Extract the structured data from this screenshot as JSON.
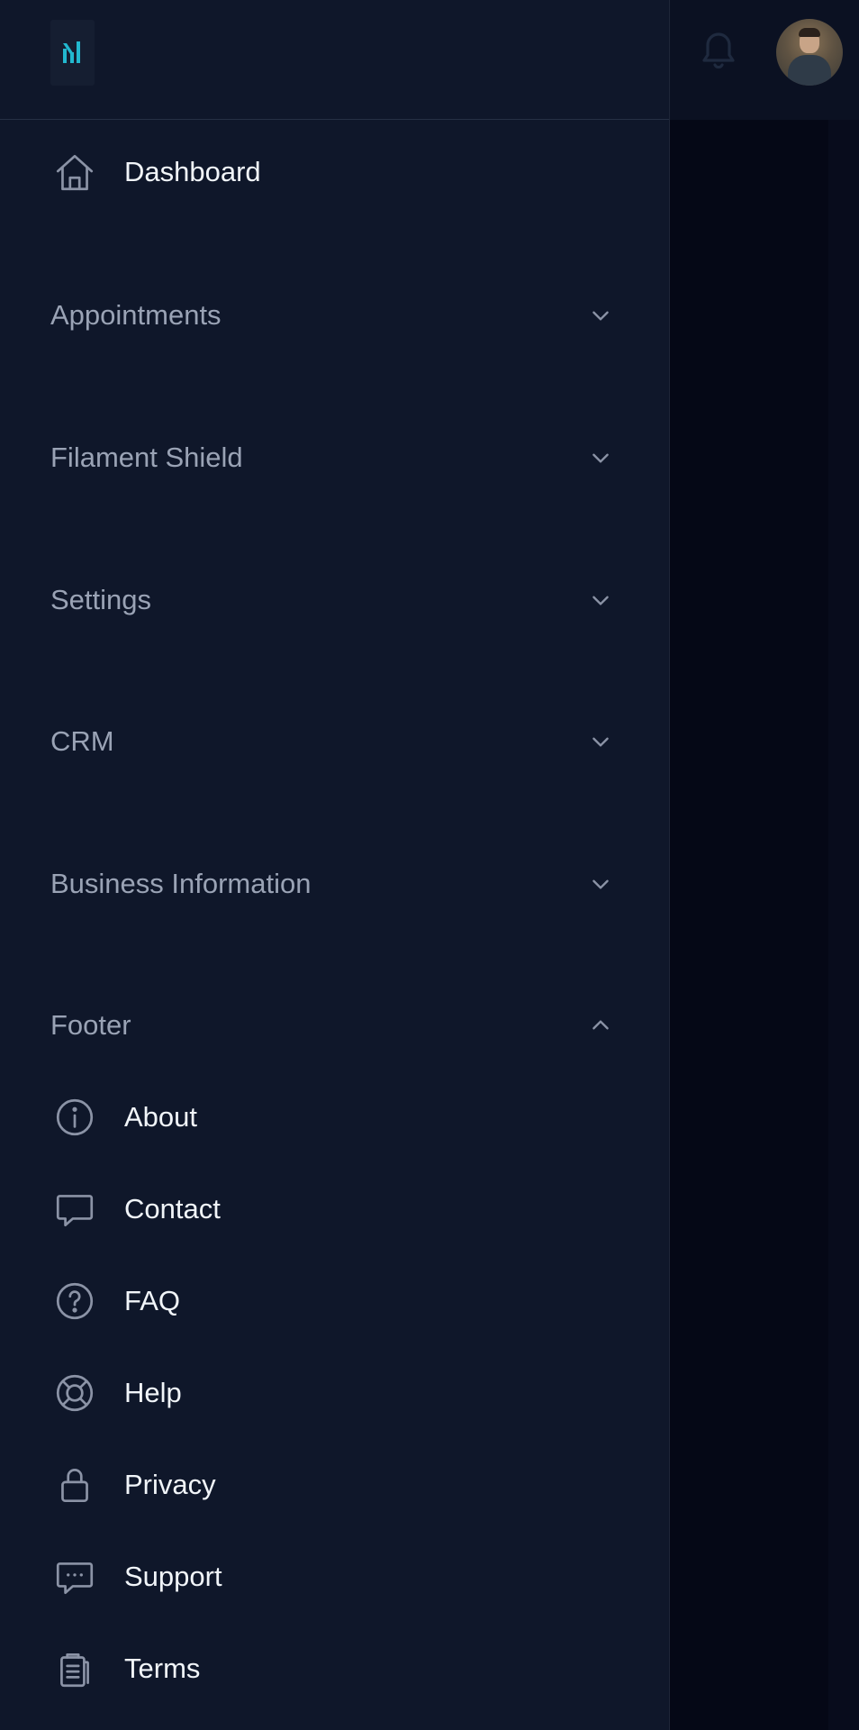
{
  "brand": {
    "logo_icon": "brand-logo-icon",
    "accent": "#22b8cf"
  },
  "topbar": {
    "notification_icon": "bell-icon",
    "avatar_icon": "user-avatar"
  },
  "sidebar": {
    "dashboard": {
      "label": "Dashboard",
      "icon": "home-icon"
    },
    "groups": [
      {
        "label": "Appointments",
        "expanded": false,
        "chevron": "chevron-down-icon"
      },
      {
        "label": "Filament Shield",
        "expanded": false,
        "chevron": "chevron-down-icon"
      },
      {
        "label": "Settings",
        "expanded": false,
        "chevron": "chevron-down-icon"
      },
      {
        "label": "CRM",
        "expanded": false,
        "chevron": "chevron-down-icon"
      },
      {
        "label": "Business Information",
        "expanded": false,
        "chevron": "chevron-down-icon"
      },
      {
        "label": "Footer",
        "expanded": true,
        "chevron": "chevron-up-icon"
      }
    ],
    "footer_items": [
      {
        "label": "About",
        "icon": "info-circle-icon"
      },
      {
        "label": "Contact",
        "icon": "chat-bubble-icon"
      },
      {
        "label": "FAQ",
        "icon": "question-circle-icon"
      },
      {
        "label": "Help",
        "icon": "lifebuoy-icon"
      },
      {
        "label": "Privacy",
        "icon": "lock-icon"
      },
      {
        "label": "Support",
        "icon": "chat-dots-icon"
      },
      {
        "label": "Terms",
        "icon": "clipboard-list-icon"
      }
    ]
  },
  "colors": {
    "sidebar_bg": "#0f172a",
    "text_primary": "#f1f5f9",
    "text_group": "#9aa3b5",
    "icon_stroke": "#8b93a6"
  }
}
